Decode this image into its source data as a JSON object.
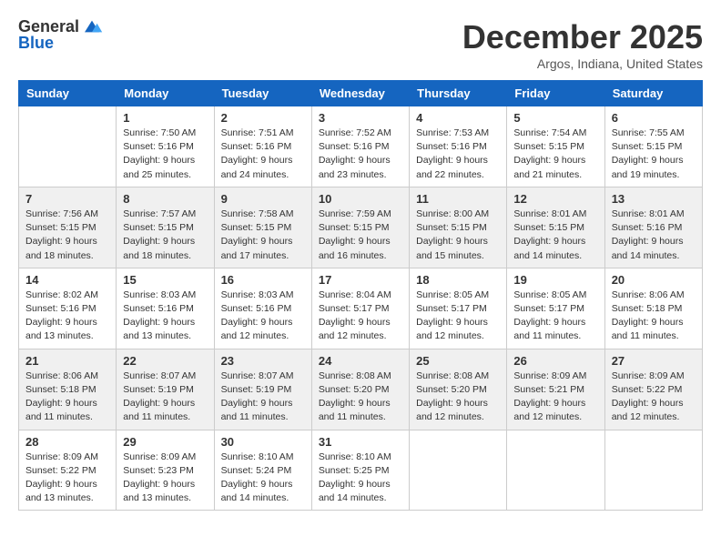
{
  "logo": {
    "general": "General",
    "blue": "Blue"
  },
  "title": {
    "month": "December 2025",
    "location": "Argos, Indiana, United States"
  },
  "header": {
    "days": [
      "Sunday",
      "Monday",
      "Tuesday",
      "Wednesday",
      "Thursday",
      "Friday",
      "Saturday"
    ]
  },
  "weeks": [
    [
      {
        "day": "",
        "sunrise": "",
        "sunset": "",
        "daylight": ""
      },
      {
        "day": "1",
        "sunrise": "Sunrise: 7:50 AM",
        "sunset": "Sunset: 5:16 PM",
        "daylight": "Daylight: 9 hours and 25 minutes."
      },
      {
        "day": "2",
        "sunrise": "Sunrise: 7:51 AM",
        "sunset": "Sunset: 5:16 PM",
        "daylight": "Daylight: 9 hours and 24 minutes."
      },
      {
        "day": "3",
        "sunrise": "Sunrise: 7:52 AM",
        "sunset": "Sunset: 5:16 PM",
        "daylight": "Daylight: 9 hours and 23 minutes."
      },
      {
        "day": "4",
        "sunrise": "Sunrise: 7:53 AM",
        "sunset": "Sunset: 5:16 PM",
        "daylight": "Daylight: 9 hours and 22 minutes."
      },
      {
        "day": "5",
        "sunrise": "Sunrise: 7:54 AM",
        "sunset": "Sunset: 5:15 PM",
        "daylight": "Daylight: 9 hours and 21 minutes."
      },
      {
        "day": "6",
        "sunrise": "Sunrise: 7:55 AM",
        "sunset": "Sunset: 5:15 PM",
        "daylight": "Daylight: 9 hours and 19 minutes."
      }
    ],
    [
      {
        "day": "7",
        "sunrise": "Sunrise: 7:56 AM",
        "sunset": "Sunset: 5:15 PM",
        "daylight": "Daylight: 9 hours and 18 minutes."
      },
      {
        "day": "8",
        "sunrise": "Sunrise: 7:57 AM",
        "sunset": "Sunset: 5:15 PM",
        "daylight": "Daylight: 9 hours and 18 minutes."
      },
      {
        "day": "9",
        "sunrise": "Sunrise: 7:58 AM",
        "sunset": "Sunset: 5:15 PM",
        "daylight": "Daylight: 9 hours and 17 minutes."
      },
      {
        "day": "10",
        "sunrise": "Sunrise: 7:59 AM",
        "sunset": "Sunset: 5:15 PM",
        "daylight": "Daylight: 9 hours and 16 minutes."
      },
      {
        "day": "11",
        "sunrise": "Sunrise: 8:00 AM",
        "sunset": "Sunset: 5:15 PM",
        "daylight": "Daylight: 9 hours and 15 minutes."
      },
      {
        "day": "12",
        "sunrise": "Sunrise: 8:01 AM",
        "sunset": "Sunset: 5:15 PM",
        "daylight": "Daylight: 9 hours and 14 minutes."
      },
      {
        "day": "13",
        "sunrise": "Sunrise: 8:01 AM",
        "sunset": "Sunset: 5:16 PM",
        "daylight": "Daylight: 9 hours and 14 minutes."
      }
    ],
    [
      {
        "day": "14",
        "sunrise": "Sunrise: 8:02 AM",
        "sunset": "Sunset: 5:16 PM",
        "daylight": "Daylight: 9 hours and 13 minutes."
      },
      {
        "day": "15",
        "sunrise": "Sunrise: 8:03 AM",
        "sunset": "Sunset: 5:16 PM",
        "daylight": "Daylight: 9 hours and 13 minutes."
      },
      {
        "day": "16",
        "sunrise": "Sunrise: 8:03 AM",
        "sunset": "Sunset: 5:16 PM",
        "daylight": "Daylight: 9 hours and 12 minutes."
      },
      {
        "day": "17",
        "sunrise": "Sunrise: 8:04 AM",
        "sunset": "Sunset: 5:17 PM",
        "daylight": "Daylight: 9 hours and 12 minutes."
      },
      {
        "day": "18",
        "sunrise": "Sunrise: 8:05 AM",
        "sunset": "Sunset: 5:17 PM",
        "daylight": "Daylight: 9 hours and 12 minutes."
      },
      {
        "day": "19",
        "sunrise": "Sunrise: 8:05 AM",
        "sunset": "Sunset: 5:17 PM",
        "daylight": "Daylight: 9 hours and 11 minutes."
      },
      {
        "day": "20",
        "sunrise": "Sunrise: 8:06 AM",
        "sunset": "Sunset: 5:18 PM",
        "daylight": "Daylight: 9 hours and 11 minutes."
      }
    ],
    [
      {
        "day": "21",
        "sunrise": "Sunrise: 8:06 AM",
        "sunset": "Sunset: 5:18 PM",
        "daylight": "Daylight: 9 hours and 11 minutes."
      },
      {
        "day": "22",
        "sunrise": "Sunrise: 8:07 AM",
        "sunset": "Sunset: 5:19 PM",
        "daylight": "Daylight: 9 hours and 11 minutes."
      },
      {
        "day": "23",
        "sunrise": "Sunrise: 8:07 AM",
        "sunset": "Sunset: 5:19 PM",
        "daylight": "Daylight: 9 hours and 11 minutes."
      },
      {
        "day": "24",
        "sunrise": "Sunrise: 8:08 AM",
        "sunset": "Sunset: 5:20 PM",
        "daylight": "Daylight: 9 hours and 11 minutes."
      },
      {
        "day": "25",
        "sunrise": "Sunrise: 8:08 AM",
        "sunset": "Sunset: 5:20 PM",
        "daylight": "Daylight: 9 hours and 12 minutes."
      },
      {
        "day": "26",
        "sunrise": "Sunrise: 8:09 AM",
        "sunset": "Sunset: 5:21 PM",
        "daylight": "Daylight: 9 hours and 12 minutes."
      },
      {
        "day": "27",
        "sunrise": "Sunrise: 8:09 AM",
        "sunset": "Sunset: 5:22 PM",
        "daylight": "Daylight: 9 hours and 12 minutes."
      }
    ],
    [
      {
        "day": "28",
        "sunrise": "Sunrise: 8:09 AM",
        "sunset": "Sunset: 5:22 PM",
        "daylight": "Daylight: 9 hours and 13 minutes."
      },
      {
        "day": "29",
        "sunrise": "Sunrise: 8:09 AM",
        "sunset": "Sunset: 5:23 PM",
        "daylight": "Daylight: 9 hours and 13 minutes."
      },
      {
        "day": "30",
        "sunrise": "Sunrise: 8:10 AM",
        "sunset": "Sunset: 5:24 PM",
        "daylight": "Daylight: 9 hours and 14 minutes."
      },
      {
        "day": "31",
        "sunrise": "Sunrise: 8:10 AM",
        "sunset": "Sunset: 5:25 PM",
        "daylight": "Daylight: 9 hours and 14 minutes."
      },
      {
        "day": "",
        "sunrise": "",
        "sunset": "",
        "daylight": ""
      },
      {
        "day": "",
        "sunrise": "",
        "sunset": "",
        "daylight": ""
      },
      {
        "day": "",
        "sunrise": "",
        "sunset": "",
        "daylight": ""
      }
    ]
  ]
}
